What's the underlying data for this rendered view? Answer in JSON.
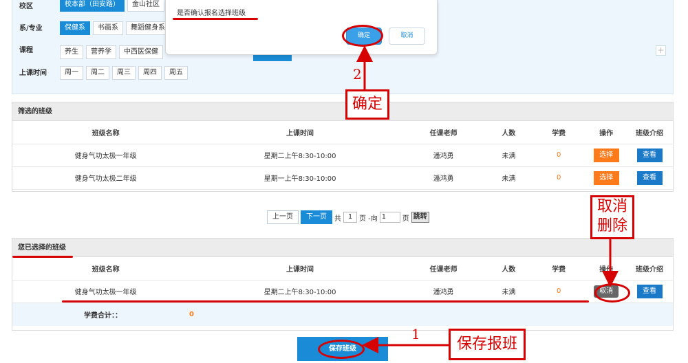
{
  "filters": {
    "campus": {
      "label": "校区",
      "options": [
        "校本部（田安路）",
        "金山社区"
      ]
    },
    "department": {
      "label": "系/专业",
      "options": [
        "保健系",
        "书画系",
        "舞蹈健身系"
      ]
    },
    "course": {
      "label": "课程",
      "options": [
        "养生",
        "营养学",
        "中西医保健"
      ]
    },
    "time": {
      "label": "上课时间",
      "options": [
        "周一",
        "周二",
        "周三",
        "周四",
        "周五"
      ]
    },
    "plus": "+"
  },
  "modal": {
    "message": "是否确认报名选择班级",
    "confirm": "确定",
    "cancel": "取消"
  },
  "filtered": {
    "title": "筛选的班级",
    "columns": [
      "班级名称",
      "上课时间",
      "任课老师",
      "人数",
      "学费",
      "操作",
      "班级介绍"
    ],
    "rows": [
      {
        "name": "健身气功太极一年级",
        "time": "星期二上午8:30-10:00",
        "teacher": "潘鸿勇",
        "count": "未满",
        "fee": "0",
        "action": "选择",
        "detail": "查看"
      },
      {
        "name": "健身气功太极二年级",
        "time": "星期一上午8:30-10:00",
        "teacher": "潘鸿勇",
        "count": "未满",
        "fee": "0",
        "action": "选择",
        "detail": "查看"
      }
    ]
  },
  "pager": {
    "prev": "上一页",
    "next": "下一页",
    "total_prefix": "共",
    "total_pages": "1",
    "page_suffix": "页 -向",
    "goto_value": "1",
    "goto_suffix": "页",
    "jump": "跳转"
  },
  "selected": {
    "title": "您已选择的班级",
    "columns": [
      "班级名称",
      "上课时间",
      "任课老师",
      "人数",
      "学费",
      "操作",
      "班级介绍"
    ],
    "rows": [
      {
        "name": "健身气功太极一年级",
        "time": "星期二上午8:30-10:00",
        "teacher": "潘鸿勇",
        "count": "未满",
        "fee": "0",
        "action": "取消",
        "detail": "查看"
      }
    ],
    "fee_total_label": "学费合计：：",
    "fee_total_value": "0"
  },
  "save_button": "保存班级",
  "annotations": {
    "step1_num": "1",
    "step1_label": "保存报班",
    "step2_num": "2",
    "step2_label": "确定",
    "remove_label_line1": "取消",
    "remove_label_line2": "删除",
    "color": "#d60000"
  }
}
